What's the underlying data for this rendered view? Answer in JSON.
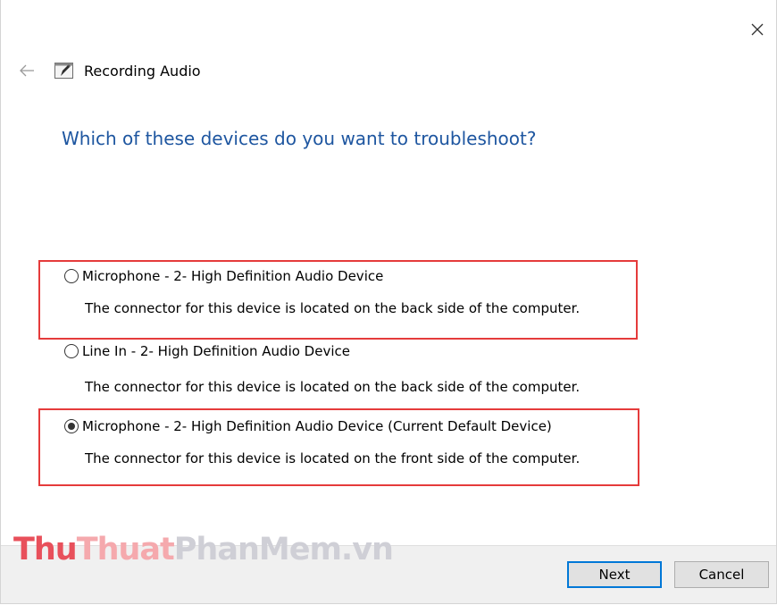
{
  "window": {
    "close_label": "✕"
  },
  "header": {
    "title": "Recording Audio"
  },
  "question": "Which of these devices do you want to troubleshoot?",
  "devices": [
    {
      "label": "Microphone - 2- High Definition Audio Device",
      "description": "The connector for this device is located on the back side of the computer.",
      "selected": false,
      "highlighted": true
    },
    {
      "label": "Line In - 2- High Definition Audio Device",
      "description": "The connector for this device is located on the back side of the computer.",
      "selected": false,
      "highlighted": false
    },
    {
      "label": "Microphone - 2- High Definition Audio Device (Current Default Device)",
      "description": "The connector for this device is located on the front side of the computer.",
      "selected": true,
      "highlighted": true
    }
  ],
  "watermark": {
    "part1": "Thu",
    "part2": "Thuat",
    "part3": "PhanMem.vn"
  },
  "buttons": {
    "next_label": "Next",
    "cancel_label": "Cancel"
  },
  "colors": {
    "question": "#1e56a0",
    "highlight_border": "#e53b3b",
    "focus_border": "#0078d7"
  }
}
